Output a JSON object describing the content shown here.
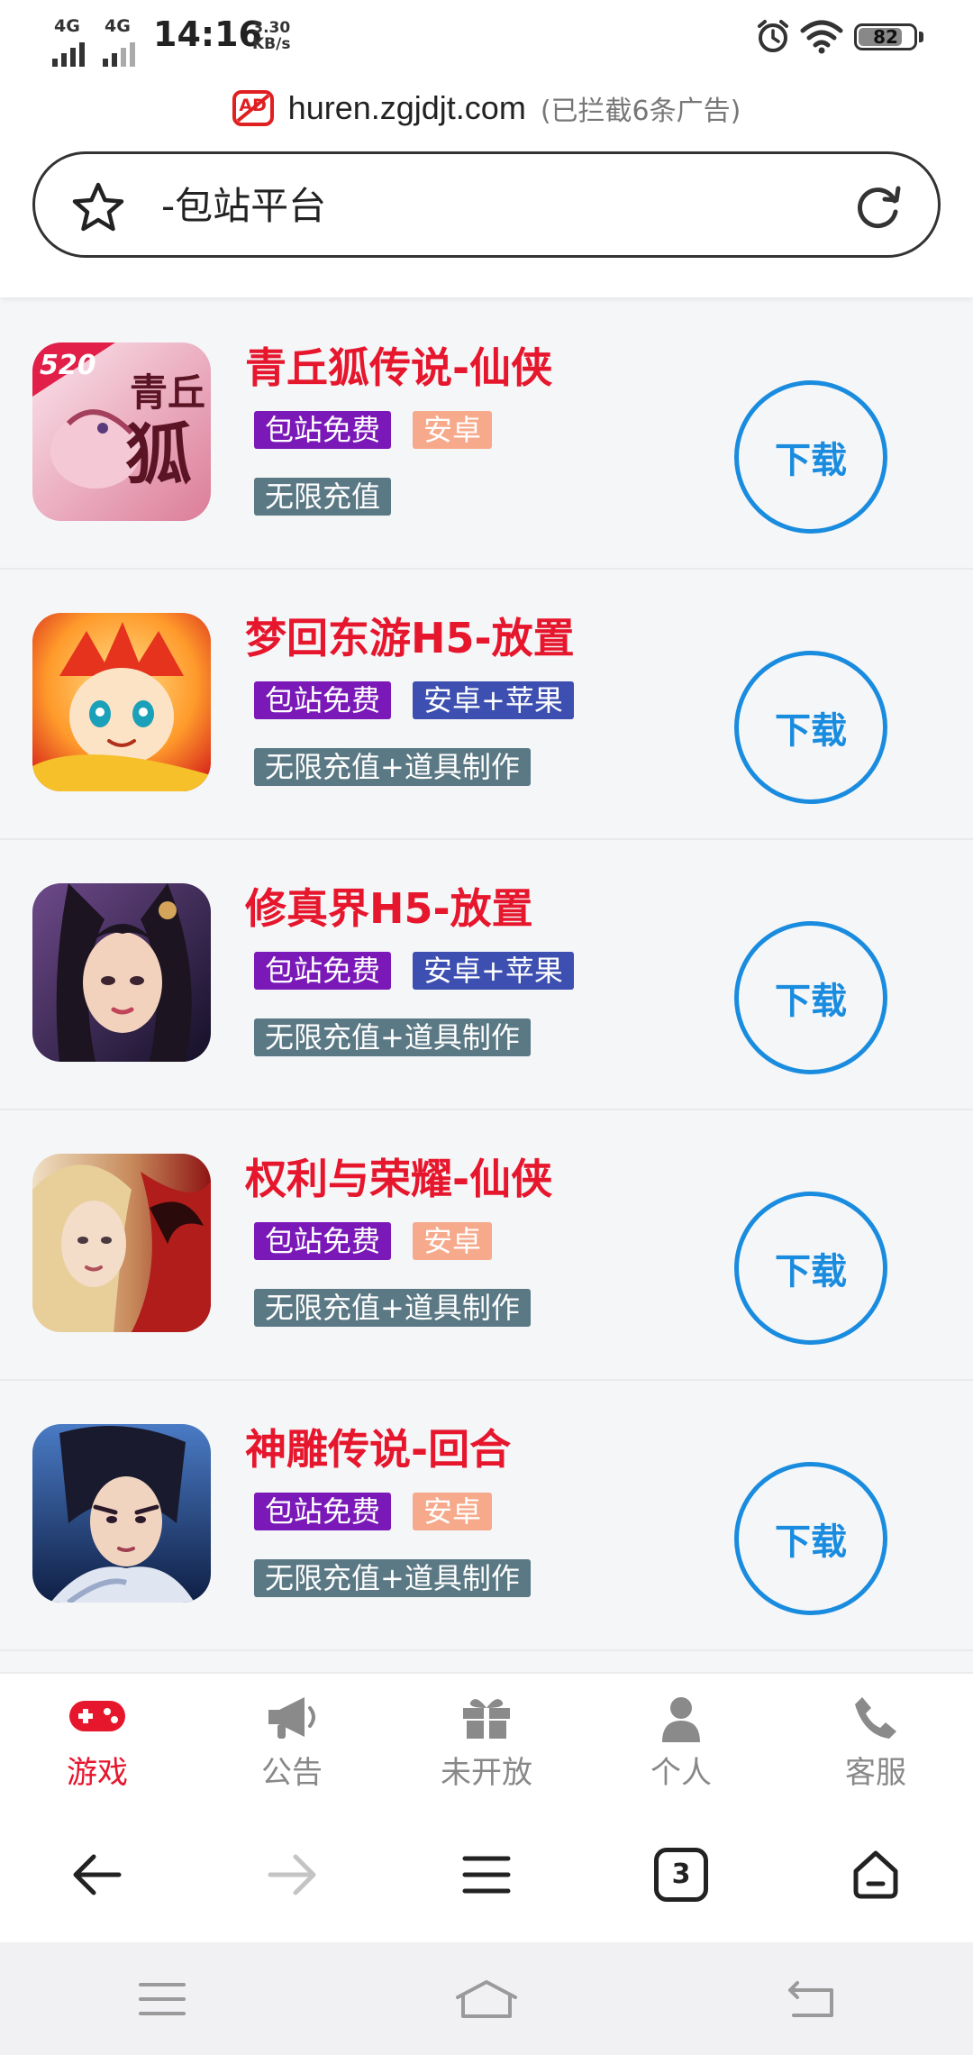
{
  "status_bar": {
    "network_1": "4G",
    "network_2": "4G",
    "time": "14:16",
    "speed_value": "3.30",
    "speed_unit": "KB/s",
    "battery": "82",
    "battery_level": 0.82,
    "icons": [
      "signal-icon",
      "alarm-icon",
      "wifi-icon",
      "battery-icon"
    ]
  },
  "browser": {
    "ad_badge": "AD",
    "domain": "huren.zgjdjt.com",
    "blocked_note": "(已拦截6条广告)",
    "search_text": "-包站平台",
    "tab_count": "3"
  },
  "games": [
    {
      "title": "青丘狐传说-仙侠",
      "tags_row1": [
        "包站免费",
        "安卓"
      ],
      "tags_row2": [
        "无限充值"
      ],
      "icon_text": "520",
      "download": "下载",
      "colors": [
        "#f6dbe4",
        "#e58aa4"
      ]
    },
    {
      "title": "梦回东游H5-放置",
      "tags_row1": [
        "包站免费",
        "安卓+苹果"
      ],
      "tags_row2": [
        "无限充值+道具制作"
      ],
      "download": "下载",
      "colors": [
        "#ffb53b",
        "#e2381c"
      ]
    },
    {
      "title": "修真界H5-放置",
      "tags_row1": [
        "包站免费",
        "安卓+苹果"
      ],
      "tags_row2": [
        "无限充值+道具制作"
      ],
      "download": "下载",
      "colors": [
        "#5a3b6c",
        "#1a1630"
      ]
    },
    {
      "title": "权利与荣耀-仙侠",
      "tags_row1": [
        "包站免费",
        "安卓"
      ],
      "tags_row2": [
        "无限充值+道具制作"
      ],
      "download": "下载",
      "colors": [
        "#e9d6b4",
        "#b2201a"
      ]
    },
    {
      "title": "神雕传说-回合",
      "tags_row1": [
        "包站免费",
        "安卓"
      ],
      "tags_row2": [
        "无限充值+道具制作"
      ],
      "download": "下载",
      "colors": [
        "#3b69b5",
        "#10224a"
      ]
    }
  ],
  "app_tabs": [
    {
      "label": "游戏",
      "icon": "gamepad-icon",
      "active": true
    },
    {
      "label": "公告",
      "icon": "megaphone-icon",
      "active": false
    },
    {
      "label": "未开放",
      "icon": "gift-icon",
      "active": false
    },
    {
      "label": "个人",
      "icon": "person-icon",
      "active": false
    },
    {
      "label": "客服",
      "icon": "phone-icon",
      "active": false
    }
  ],
  "colors": {
    "title_red": "#e6162d",
    "accent_blue": "#1a8cdf",
    "tag_purple": "#7b18b8",
    "tag_salmon": "#f6a98b",
    "tag_indigo": "#3d4fb0",
    "tag_slate": "#5b7985"
  }
}
